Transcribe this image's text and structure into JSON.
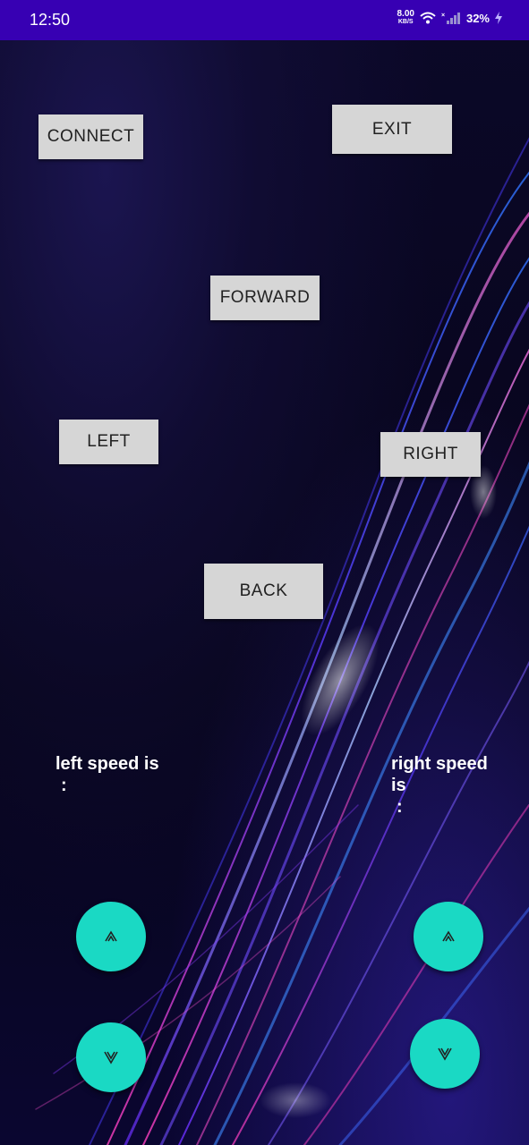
{
  "status_bar": {
    "time": "12:50",
    "net_speed_value": "8.00",
    "net_speed_unit": "KB/S",
    "battery": "32%"
  },
  "buttons": {
    "connect": "CONNECT",
    "exit": "EXIT",
    "forward": "FORWARD",
    "left": "LEFT",
    "right": "RIGHT",
    "back": "BACK"
  },
  "speed": {
    "left_label": "left speed is",
    "left_value": ":",
    "right_label": "right speed is",
    "right_value": ":"
  },
  "icons": {
    "left_up": "double-chevron-up-icon",
    "left_down": "double-chevron-down-icon",
    "right_up": "double-chevron-up-icon",
    "right_down": "double-chevron-down-icon"
  },
  "colors": {
    "status_bar": "#3700b3",
    "button_bg": "#d6d6d6",
    "fab": "#1ad9c4"
  }
}
